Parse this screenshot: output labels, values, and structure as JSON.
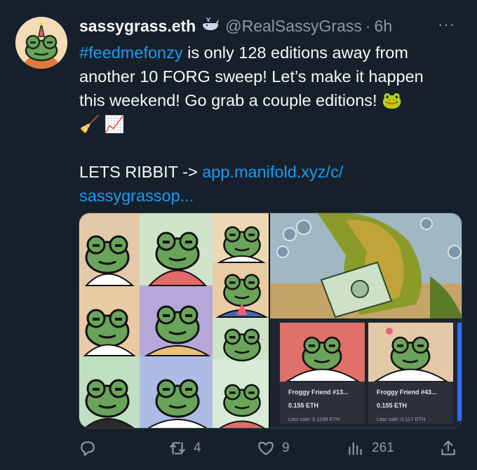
{
  "tweet": {
    "display_name": "sassygrass.eth",
    "handle": "@RealSassyGrass",
    "separator": "·",
    "time": "6h",
    "more_label": "···",
    "text_lines": [
      {
        "hashtag": "#feedmefonzy",
        "rest": " is only 128 editions away from"
      },
      {
        "text": "another 10 FORG sweep! Let’s make it happen"
      },
      {
        "text": "this weekend! Go grab a couple editions! 🐸"
      },
      {
        "text": "🧹 📈"
      }
    ],
    "cta_prefix": "LETS RIBBIT -> ",
    "link_line1": "app.manifold.xyz/c/",
    "link_line2": "sassygrassop..."
  },
  "media": {
    "cards": [
      {
        "title": "Froggy Friend #13...",
        "price": "0.155 ETH",
        "last_sale": "Last sale: 0.1199 ETH"
      },
      {
        "title": "Froggy Friend #43...",
        "price": "0.155 ETH",
        "last_sale": "Last sale: 0.117 ETH"
      }
    ]
  },
  "actions": {
    "reply_count": "",
    "retweet_count": "4",
    "like_count": "9",
    "views_count": "261"
  },
  "colors": {
    "background": "#15202b",
    "accent": "#1d9bf0",
    "muted": "#8b98a5",
    "frog_green": "#6aa45a"
  }
}
